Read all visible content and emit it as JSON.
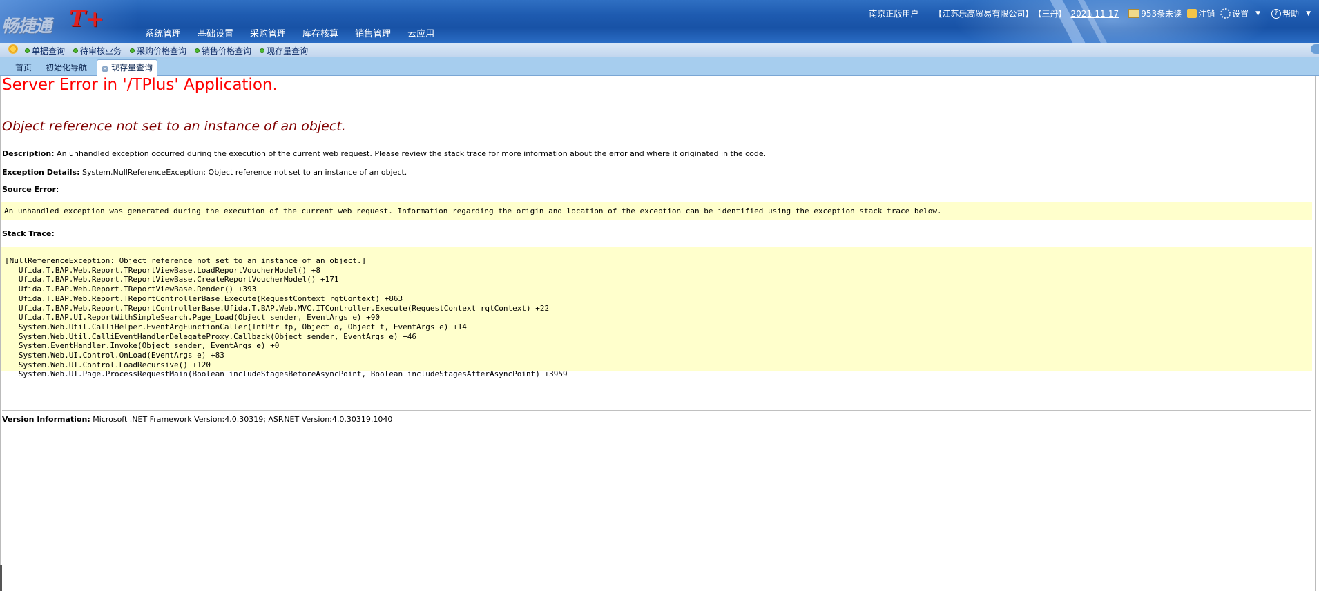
{
  "app": {
    "logo_cn": "畅捷通",
    "logo_brand": "T+"
  },
  "main_menu": [
    "系统管理",
    "基础设置",
    "采购管理",
    "库存核算",
    "销售管理",
    "云应用"
  ],
  "user_bar": {
    "user": "南京正版用户",
    "company": "【江苏乐高贸易有限公司】",
    "name": "【王丹】",
    "date": "2021-11-17",
    "messages": "953条未读",
    "logout": "注销",
    "settings": "设置",
    "help": "帮助"
  },
  "quick_links": [
    "单据查询",
    "待审核业务",
    "采购价格查询",
    "销售价格查询",
    "现存量查询"
  ],
  "tabs": [
    {
      "label": "首页",
      "active": false
    },
    {
      "label": "初始化导航",
      "active": false
    },
    {
      "label": "现存量查询",
      "active": true
    }
  ],
  "error": {
    "title": "Server Error in '/TPlus' Application.",
    "subtitle": "Object reference not set to an instance of an object.",
    "description_label": "Description:",
    "description": " An unhandled exception occurred during the execution of the current web request. Please review the stack trace for more information about the error and where it originated in the code.",
    "exception_label": "Exception Details:",
    "exception": " System.NullReferenceException: Object reference not set to an instance of an object.",
    "source_label": "Source Error:",
    "source_text": "An unhandled exception was generated during the execution of the current web request. Information regarding the origin and location of the exception can be identified using the exception stack trace below.",
    "stack_label": "Stack Trace:",
    "stack_trace": "[NullReferenceException: Object reference not set to an instance of an object.]\n   Ufida.T.BAP.Web.Report.TReportViewBase.LoadReportVoucherModel() +8\n   Ufida.T.BAP.Web.Report.TReportViewBase.CreateReportVoucherModel() +171\n   Ufida.T.BAP.Web.Report.TReportViewBase.Render() +393\n   Ufida.T.BAP.Web.Report.TReportControllerBase.Execute(RequestContext rqtContext) +863\n   Ufida.T.BAP.Web.Report.TReportControllerBase.Ufida.T.BAP.Web.MVC.ITController.Execute(RequestContext rqtContext) +22\n   Ufida.T.BAP.UI.ReportWithSimpleSearch.Page_Load(Object sender, EventArgs e) +90\n   System.Web.Util.CalliHelper.EventArgFunctionCaller(IntPtr fp, Object o, Object t, EventArgs e) +14\n   System.Web.Util.CalliEventHandlerDelegateProxy.Callback(Object sender, EventArgs e) +46\n   System.EventHandler.Invoke(Object sender, EventArgs e) +0\n   System.Web.UI.Control.OnLoad(EventArgs e) +83\n   System.Web.UI.Control.LoadRecursive() +120\n   System.Web.UI.Page.ProcessRequestMain(Boolean includeStagesBeforeAsyncPoint, Boolean includeStagesAfterAsyncPoint) +3959",
    "version_label": "Version Information:",
    "version": " Microsoft .NET Framework Version:4.0.30319; ASP.NET Version:4.0.30319.1040"
  }
}
